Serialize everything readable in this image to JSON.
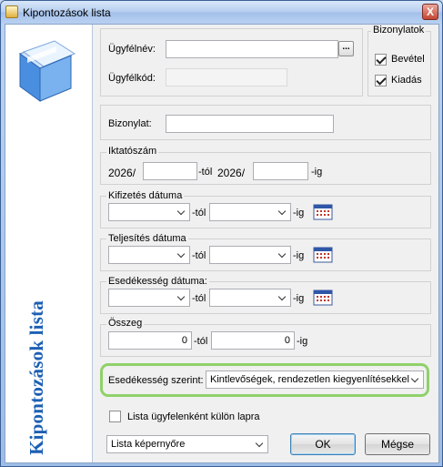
{
  "window": {
    "title": "Kipontozások lista",
    "close_label": "X"
  },
  "sidebar": {
    "title": "Kipontozások lista",
    "icon": "folder-icon"
  },
  "client": {
    "client_name_label": "Ügyfélnév:",
    "client_name_value": "",
    "more_label": "...",
    "client_code_label": "Ügyfélkód:",
    "client_code_value": ""
  },
  "documents": {
    "legend": "Bizonylatok",
    "income_label": "Bevétel",
    "income_checked": true,
    "expense_label": "Kiadás",
    "expense_checked": true
  },
  "voucher": {
    "label": "Bizonylat:",
    "value": ""
  },
  "filing": {
    "legend": "Iktatószám",
    "prefix_from": "2026/",
    "from_value": "",
    "from_suffix": "-tól",
    "prefix_to": "2026/",
    "to_value": "",
    "to_suffix": "-ig"
  },
  "payment_date": {
    "legend": "Kifizetés dátuma",
    "from_value": "",
    "from_suffix": "-tól",
    "to_value": "",
    "to_suffix": "-ig",
    "icon": "calendar-icon"
  },
  "completion_date": {
    "legend": "Teljesítés dátuma",
    "from_value": "",
    "from_suffix": "-tól",
    "to_value": "",
    "to_suffix": "-ig",
    "icon": "calendar-icon"
  },
  "due_date": {
    "legend": "Esedékesség dátuma:",
    "from_value": "",
    "from_suffix": "-tól",
    "to_value": "",
    "to_suffix": "-ig",
    "icon": "calendar-icon"
  },
  "amount": {
    "legend": "Összeg",
    "from_value": "0",
    "from_suffix": "-tól",
    "to_value": "0",
    "to_suffix": "-ig"
  },
  "due_filter": {
    "label": "Esedékesség szerint:",
    "value": "Kintlevőségek, rendezetlen kiegyenlítésekkel",
    "highlight_color": "#8fd16a"
  },
  "separate_pages": {
    "label": "Lista ügyfelenként külön lapra",
    "checked": false
  },
  "output": {
    "value": "Lista képernyőre"
  },
  "buttons": {
    "ok": "OK",
    "cancel": "Mégse"
  }
}
